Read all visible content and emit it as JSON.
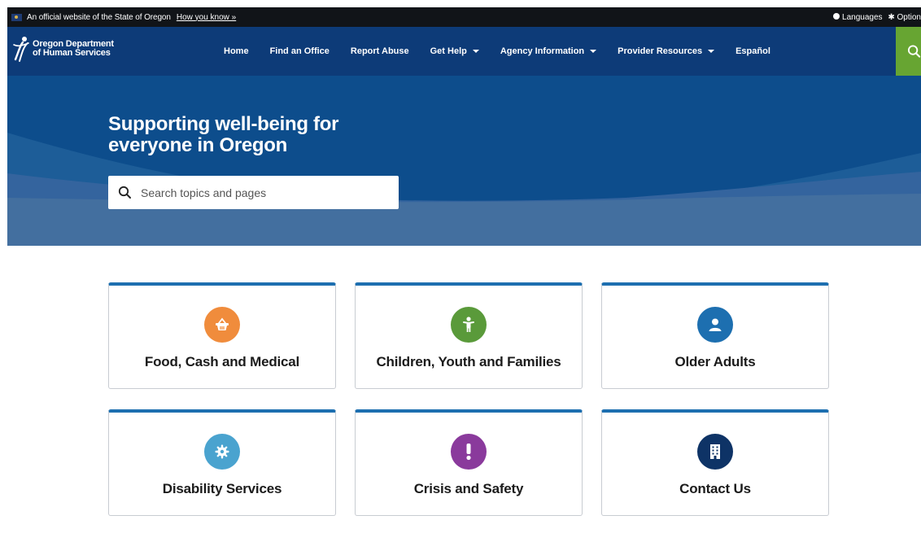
{
  "topbar": {
    "official_text": "An official website of the State of Oregon",
    "how_link": "How you know »",
    "languages": "Languages",
    "options": "Option"
  },
  "header": {
    "logo_line1": "Oregon Department",
    "logo_line2": "of Human Services",
    "nav": [
      {
        "label": "Home"
      },
      {
        "label": "Find an Office"
      },
      {
        "label": "Report Abuse"
      },
      {
        "label": "Get Help"
      },
      {
        "label": "Agency Information"
      },
      {
        "label": "Provider Resources"
      },
      {
        "label": "Español"
      }
    ],
    "search_icon": "search-icon"
  },
  "hero": {
    "title_line1": "Supporting well-being for",
    "title_line2": "everyone in Oregon",
    "search_placeholder": "Search topics and pages"
  },
  "cards": [
    {
      "label": "Food, Cash and Medical",
      "icon": "basket-icon",
      "color": "#f08c3c"
    },
    {
      "label": "Children, Youth and Families",
      "icon": "child-icon",
      "color": "#5a9a3a"
    },
    {
      "label": "Older Adults",
      "icon": "person-icon",
      "color": "#1d6fb0"
    },
    {
      "label": "Disability Services",
      "icon": "gear-icon",
      "color": "#4aa3cf"
    },
    {
      "label": "Crisis and Safety",
      "icon": "exclamation-icon",
      "color": "#8a3a9c"
    },
    {
      "label": "Contact Us",
      "icon": "building-icon",
      "color": "#0e3366"
    }
  ],
  "colors": {
    "nav_background": "#0d3b78",
    "hero_background": "#0d4d8c",
    "search_button": "#67a532",
    "card_accent": "#1d6fb0"
  }
}
